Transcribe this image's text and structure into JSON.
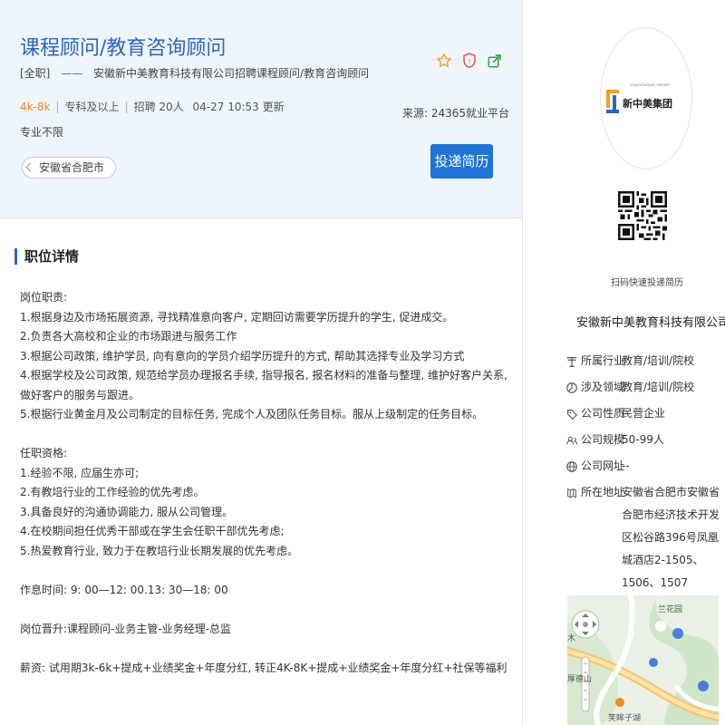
{
  "job": {
    "title": "课程顾问/教育咨询顾问",
    "type_tag": "[全职]",
    "dash": "——",
    "company_job": "安徽新中美教育科技有限公司招聘课程顾问/教育咨询顾问",
    "salary": "4k-8k",
    "education": "专科及以上",
    "recruit": "招聘 20人",
    "updated": "04-27 10:53 更新",
    "major": "专业不限",
    "location": "安徽省合肥市",
    "source": "来源:   24365就业平台",
    "apply_label": "投递简历"
  },
  "section": {
    "title": "职位详情"
  },
  "description": [
    "岗位职责:",
    "1.根据身边及市场拓展资源, 寻找精准意向客户, 定期回访需要学历提升的学生, 促进成交。",
    "2.负责各大高校和企业的市场跟进与服务工作",
    "3.根据公司政策, 维护学员, 向有意向的学员介绍学历提升的方式, 帮助其选择专业及学习方式",
    "4.根据学校及公司政策, 规范给学员办理报名手续, 指导报名, 报名材料的准备与整理, 维护好客户关系, 做好客户的服务与跟进。",
    "5.根据行业黄金月及公司制定的目标任务, 完成个人及团队任务目标。服从上级制定的任务目标。",
    "",
    "任职资格:",
    "1.经验不限, 应届生亦可;",
    "2.有教培行业的工作经验的优先考虑。",
    "3.具备良好的沟通协调能力, 服从公司管理。",
    "4.在校期间担任优秀干部或在学生会任职干部优先考虑;",
    "5.热爱教育行业, 致力于在教培行业长期发展的优先考虑。",
    "",
    "作息时间:  9:  00—12:  00.13:  30—18:  00",
    "",
    "岗位晋升:课程顾问-业务主管-业务经理-总监",
    "",
    "薪资:  试用期3k-6k+提成+业绩奖金+年度分红,  转正4K-8K+提成+业绩奖金+年度分红+社保等福利"
  ],
  "company": {
    "logo_text": "新中美集团",
    "logo_sub": "XINZHONGMEI GROUP",
    "qr_caption": "扫码快速投递简历",
    "name": "安徽新中美教育科技有限公司",
    "info": [
      {
        "icon": "industry-icon",
        "label": "所属行业",
        "value": "教育/培训/院校"
      },
      {
        "icon": "field-icon",
        "label": "涉及领域",
        "value": "教育/培训/院校"
      },
      {
        "icon": "nature-icon",
        "label": "公司性质",
        "value": "民营企业"
      },
      {
        "icon": "scale-icon",
        "label": "公司规模",
        "value": "50-99人"
      },
      {
        "icon": "website-icon",
        "label": "公司网址",
        "value": "--"
      },
      {
        "icon": "address-icon",
        "label": "所在地址",
        "value": "安徽省合肥市安徽省合肥市经济技术开发区松谷路396号凤凰城酒店2-1505、1506、1507"
      }
    ]
  },
  "map": {
    "labels": [
      "兰花园",
      "木",
      "厚德山",
      "笑眸子湖"
    ]
  },
  "colors": {
    "title_blue": "#2c66c3",
    "apply_blue": "#1d74d6",
    "salary_orange": "#f08a24",
    "header_bg": "#eef5fc"
  }
}
